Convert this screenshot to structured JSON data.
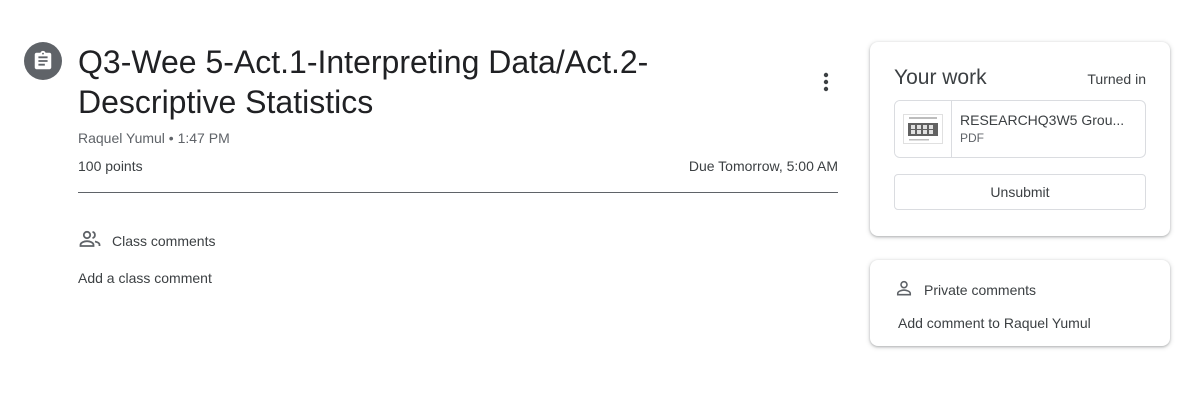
{
  "assignment": {
    "icon": "assignment-icon",
    "title": "Q3-Wee 5-Act.1-Interpreting Data/Act.2-Descriptive Statistics",
    "meta": "Raquel Yumul • 1:47 PM",
    "points": "100 points",
    "due": "Due Tomorrow, 5:00 AM"
  },
  "class_comments": {
    "label": "Class comments",
    "add": "Add a class comment"
  },
  "your_work": {
    "title": "Your work",
    "status": "Turned in",
    "attachment": {
      "name": "RESEARCHQ3W5 Grou...",
      "type": "PDF"
    },
    "unsubmit_label": "Unsubmit"
  },
  "private_comments": {
    "label": "Private comments",
    "add": "Add comment to Raquel Yumul"
  },
  "colors": {
    "icon_bg": "#5f6368",
    "text": "#3c4043",
    "border": "#dadce0"
  }
}
